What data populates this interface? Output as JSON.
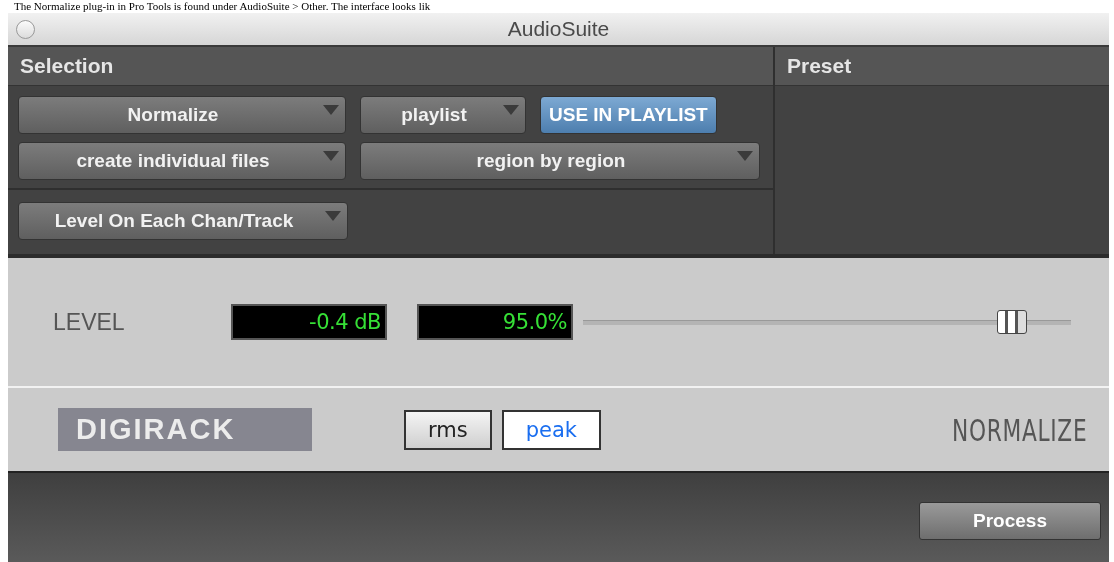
{
  "caption": "The Normalize plug-in in Pro Tools is found under AudioSuite > Other. The interface looks lik",
  "window": {
    "title": "AudioSuite"
  },
  "selection": {
    "title": "Selection",
    "row1": [
      {
        "kind": "dropdown",
        "label": "Normalize"
      },
      {
        "kind": "dropdown",
        "label": "playlist"
      },
      {
        "kind": "toggle",
        "label": "USE IN PLAYLIST",
        "on": true
      }
    ],
    "row2": [
      {
        "kind": "dropdown",
        "label": "create individual files"
      },
      {
        "kind": "dropdown",
        "label": "region by region"
      }
    ],
    "mode": {
      "label": "Level On Each Chan/Track"
    }
  },
  "preset": {
    "title": "Preset"
  },
  "level": {
    "label": "LEVEL",
    "db": "-0.4 dB",
    "percent": "95.0%",
    "level": 0.88
  },
  "footer": {
    "brand": "DIGIRACK",
    "modes": [
      {
        "label": "rms",
        "selected": false
      },
      {
        "label": "peak",
        "selected": true
      }
    ],
    "plugin": "NORMALIZE"
  },
  "process": {
    "label": "Process"
  }
}
